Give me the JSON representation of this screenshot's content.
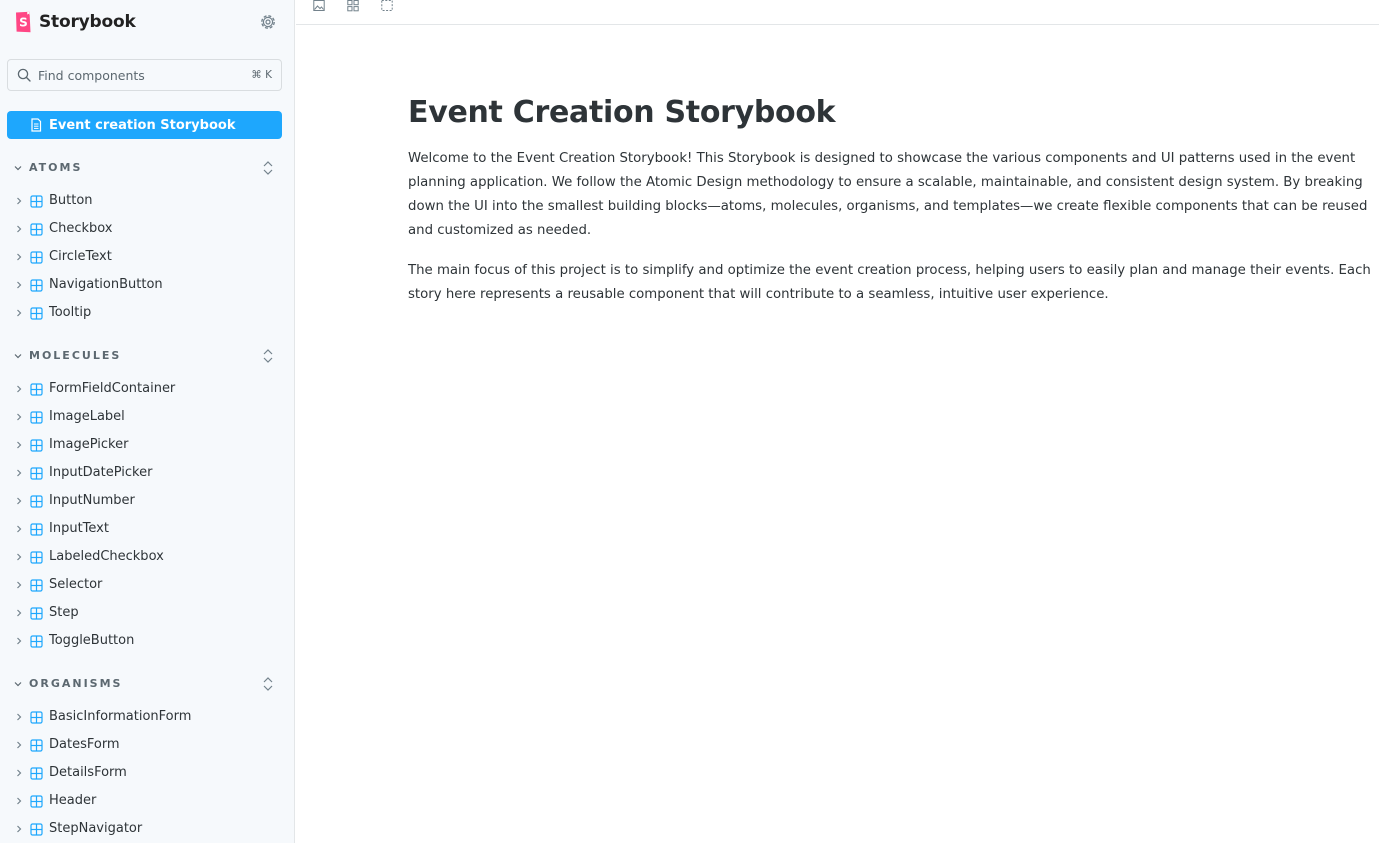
{
  "brand": {
    "name": "Storybook",
    "accent": "#ff4785"
  },
  "search": {
    "placeholder": "Find components",
    "shortcut": "⌘ K"
  },
  "active_doc": {
    "label": "Event creation Storybook",
    "color": "#1ea7fd"
  },
  "groups": [
    {
      "title": "ATOMS",
      "items": [
        "Button",
        "Checkbox",
        "CircleText",
        "NavigationButton",
        "Tooltip"
      ]
    },
    {
      "title": "MOLECULES",
      "items": [
        "FormFieldContainer",
        "ImageLabel",
        "ImagePicker",
        "InputDatePicker",
        "InputNumber",
        "InputText",
        "LabeledCheckbox",
        "Selector",
        "Step",
        "ToggleButton"
      ]
    },
    {
      "title": "ORGANISMS",
      "items": [
        "BasicInformationForm",
        "DatesForm",
        "DetailsForm",
        "Header",
        "StepNavigator"
      ]
    }
  ],
  "toolbar": {
    "icons": [
      "image-icon",
      "grid-icon",
      "outline-icon"
    ]
  },
  "main": {
    "title": "Event Creation Storybook",
    "paragraphs": [
      "Welcome to the Event Creation Storybook! This Storybook is designed to showcase the various components and UI patterns used in the event planning application. We follow the Atomic Design methodology to ensure a scalable, maintainable, and consistent design system. By breaking down the UI into the smallest building blocks—atoms, molecules, organisms, and templates—we create flexible components that can be reused and customized as needed.",
      "The main focus of this project is to simplify and optimize the event creation process, helping users to easily plan and manage their events. Each story here represents a reusable component that will contribute to a seamless, intuitive user experience."
    ]
  },
  "colors": {
    "component_icon": "#1ea7fd",
    "text": "#2e3438",
    "muted": "#5c6870"
  }
}
